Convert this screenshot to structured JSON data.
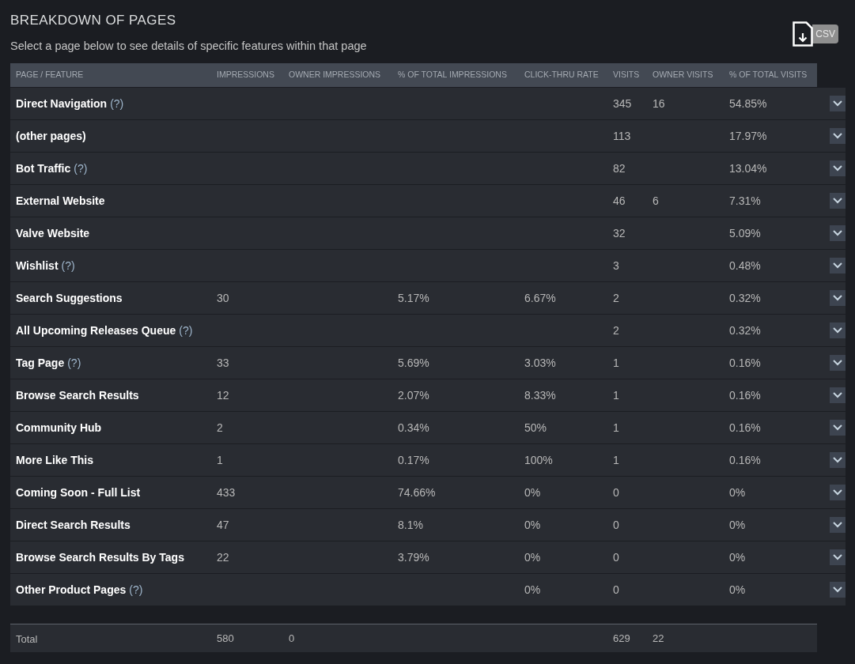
{
  "title": "BREAKDOWN OF PAGES",
  "subtitle": "Select a page below to see details of specific features within that page",
  "export_button": "CSV",
  "columns": [
    "PAGE / FEATURE",
    "IMPRESSIONS",
    "OWNER IMPRESSIONS",
    "% OF TOTAL IMPRESSIONS",
    "CLICK-THRU RATE",
    "VISITS",
    "OWNER VISITS",
    "% OF TOTAL VISITS"
  ],
  "rows": [
    {
      "page": "Direct Navigation",
      "help": "(?)",
      "cells": [
        null,
        null,
        null,
        null,
        "345",
        "16",
        "54.85%"
      ]
    },
    {
      "page": "(other pages)",
      "cells": [
        null,
        null,
        null,
        null,
        "113",
        null,
        "17.97%"
      ]
    },
    {
      "page": "Bot Traffic",
      "help": "(?)",
      "cells": [
        null,
        null,
        null,
        null,
        "82",
        null,
        "13.04%"
      ]
    },
    {
      "page": "External Website",
      "cells": [
        null,
        null,
        null,
        null,
        "46",
        "6",
        "7.31%"
      ]
    },
    {
      "page": "Valve Website",
      "cells": [
        null,
        null,
        null,
        null,
        "32",
        null,
        "5.09%"
      ]
    },
    {
      "page": "Wishlist",
      "help": "(?)",
      "cells": [
        null,
        null,
        null,
        null,
        "3",
        null,
        "0.48%"
      ]
    },
    {
      "page": "Search Suggestions",
      "cells": [
        "30",
        null,
        "5.17%",
        "6.67%",
        "2",
        null,
        "0.32%"
      ]
    },
    {
      "page": "All Upcoming Releases Queue",
      "help": "(?)",
      "cells": [
        null,
        null,
        null,
        null,
        "2",
        null,
        "0.32%"
      ]
    },
    {
      "page": "Tag Page",
      "help": "(?)",
      "cells": [
        "33",
        null,
        "5.69%",
        "3.03%",
        "1",
        null,
        "0.16%"
      ]
    },
    {
      "page": "Browse Search Results",
      "cells": [
        "12",
        null,
        "2.07%",
        "8.33%",
        "1",
        null,
        "0.16%"
      ]
    },
    {
      "page": "Community Hub",
      "cells": [
        "2",
        null,
        "0.34%",
        "50%",
        "1",
        null,
        "0.16%"
      ]
    },
    {
      "page": "More Like This",
      "cells": [
        "1",
        null,
        "0.17%",
        "100%",
        "1",
        null,
        "0.16%"
      ]
    },
    {
      "page": "Coming Soon - Full List",
      "cells": [
        "433",
        null,
        "74.66%",
        "0%",
        "0",
        null,
        "0%"
      ]
    },
    {
      "page": "Direct Search Results",
      "cells": [
        "47",
        null,
        "8.1%",
        "0%",
        "0",
        null,
        "0%"
      ]
    },
    {
      "page": "Browse Search Results By Tags",
      "cells": [
        "22",
        null,
        "3.79%",
        "0%",
        "0",
        null,
        "0%"
      ]
    },
    {
      "page": "Other Product Pages",
      "help": "(?)",
      "cells": [
        null,
        null,
        null,
        "0%",
        "0",
        null,
        "0%"
      ]
    }
  ],
  "total": {
    "label": "Total",
    "cells": [
      "580",
      "0",
      null,
      null,
      "629",
      "22",
      null
    ]
  }
}
